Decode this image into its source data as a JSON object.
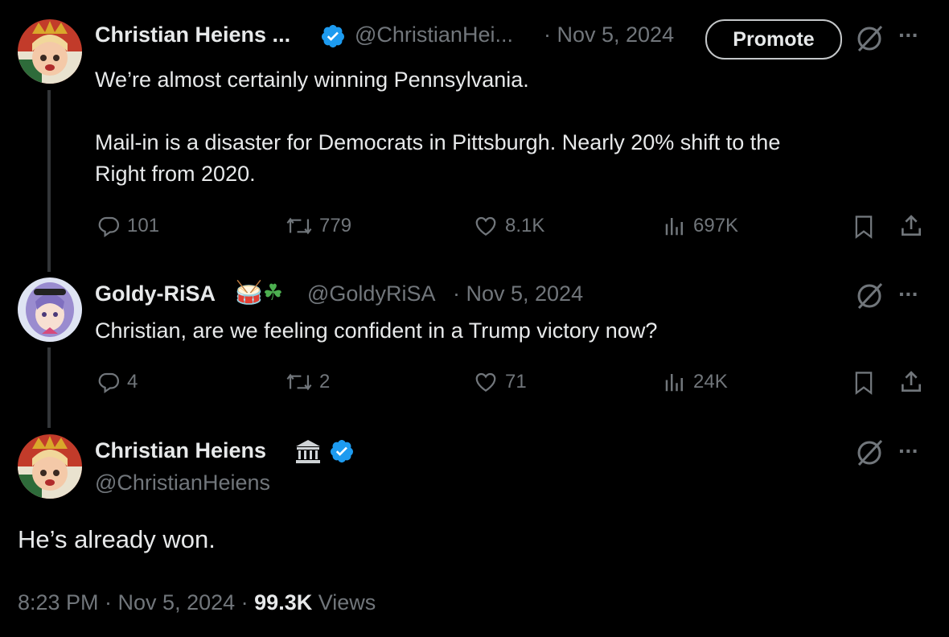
{
  "tweet1": {
    "author": "Christian Heiens ...",
    "handle": "@ChristianHei...",
    "date": "· Nov 5, 2024",
    "promote_label": "Promote",
    "text_line1": "We’re almost certainly winning Pennsylvania.",
    "text_line2": "Mail-in is a disaster for Democrats in Pittsburgh. Nearly 20% shift to the",
    "text_line3": "Right from 2020.",
    "replies": "101",
    "retweets": "779",
    "likes": "8.1K",
    "views": "697K"
  },
  "tweet2": {
    "author": "Goldy-RiSA",
    "emoji": "🥁☘",
    "handle": "@GoldyRiSA",
    "date": "· Nov 5, 2024",
    "text": "Christian, are we feeling confident in a Trump victory now?",
    "replies": "4",
    "retweets": "2",
    "likes": "71",
    "views": "24K"
  },
  "tweet3": {
    "author": "Christian Heiens",
    "handle": "@ChristianHeiens",
    "text": "He’s already won.",
    "time": "8:23 PM · Nov 5, 2024 ·",
    "views_count": "99.3K",
    "views_label": "Views"
  },
  "icons": {
    "more": "more-options-icon",
    "grok": "grok-slash-icon",
    "verified_color": "#1d9bf0"
  }
}
